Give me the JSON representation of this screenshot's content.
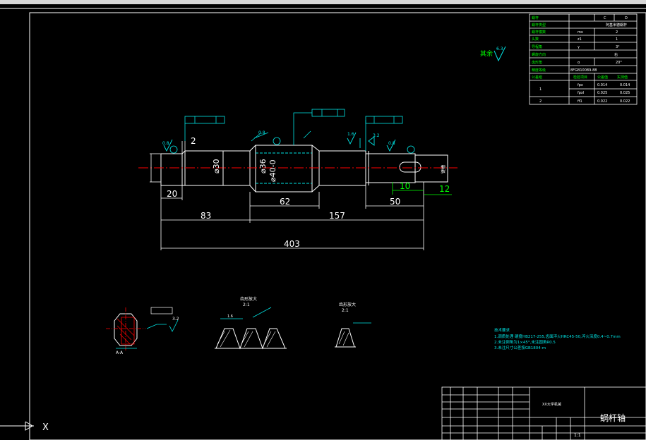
{
  "title_block": {
    "drawing_name": "蜗杆轴",
    "scale_label": "1:1",
    "company_label": "XX大学机械"
  },
  "param_table": {
    "rows": [
      [
        "蜗杆",
        "",
        "C",
        "D"
      ],
      [
        "蜗杆类型",
        "",
        "阿基米德蜗杆",
        ""
      ],
      [
        "蜗杆模数",
        "mx",
        "",
        "2"
      ],
      [
        "头数",
        "z1",
        "",
        "1"
      ],
      [
        "导程角",
        "γ",
        "",
        "3°"
      ],
      [
        "螺旋方向",
        "",
        "右",
        ""
      ],
      [
        "齿形角",
        "α",
        "",
        "20°"
      ],
      [
        "精度等级",
        "",
        "8FGB10089-88",
        ""
      ],
      [
        "公差组",
        "检验项目",
        "公差值",
        "实测值"
      ],
      [
        "1",
        "fpx",
        "0.014",
        "0.014"
      ],
      [
        "",
        "fpxl",
        "0.025",
        "0.025"
      ],
      [
        "2",
        "ff1",
        "0.022",
        "0.022"
      ]
    ]
  },
  "dimensions": {
    "d20": "20",
    "d83": "83",
    "d62": "62",
    "d157": "157",
    "d403": "403",
    "d50": "50",
    "d10": "10",
    "d12": "12",
    "d2": "2",
    "phi30": "⌀30",
    "phi36": "⌀36",
    "phi40": "⌀40-0",
    "key_keyway": "键槽"
  },
  "surface": {
    "rest_label": "其余",
    "rest_value": "6.3",
    "r08a": "0.8",
    "r08b": "0.8",
    "r08c": "0.8",
    "r16": "1.6",
    "r32a": "3.2",
    "r32b": "3.2"
  },
  "sections": {
    "ab_label": "A-A",
    "tooth_label": "齿形放大",
    "tooth_scale": "2:1",
    "tooth2_label": "齿形放大",
    "tooth2_scale": "2:1",
    "r16_tag": "1.6"
  },
  "tech_req": {
    "title": "技术要求",
    "lines": [
      "1.调质处理 硬度HB217-255,齿面淬火HRC45-50,淬火深度0.4~0.7mm",
      "2.未注倒角为1×45°,未注圆角R0.5",
      "3.未注尺寸公差按GB1804-m"
    ]
  },
  "cursor": {
    "x_label": "X"
  }
}
